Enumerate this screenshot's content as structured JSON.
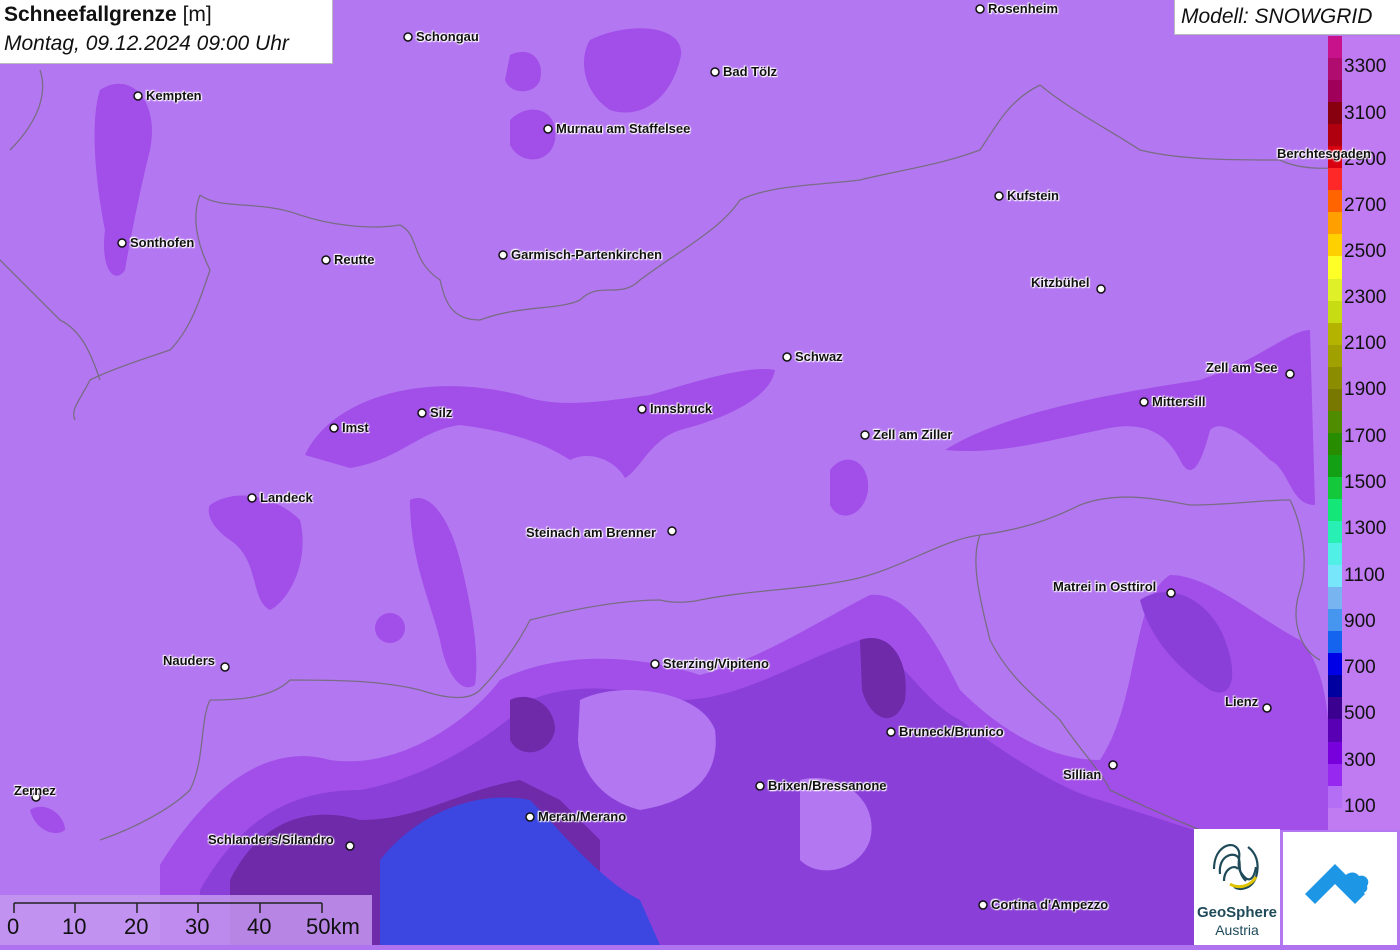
{
  "title": {
    "main": "Schneefallgrenze",
    "unit": "[m]",
    "datetime": "Montag, 09.12.2024 09:00 Uhr"
  },
  "model": "Modell: SNOWGRID",
  "legend": {
    "labels": [
      "3300",
      "3100",
      "2900",
      "2700",
      "2500",
      "2300",
      "2100",
      "1900",
      "1700",
      "1500",
      "1300",
      "1100",
      "900",
      "700",
      "500",
      "300",
      "100"
    ],
    "colors": [
      "#c8128c",
      "#b00c70",
      "#a0005a",
      "#880010",
      "#b00010",
      "#d80010",
      "#ff2828",
      "#ff6400",
      "#ffa000",
      "#ffd000",
      "#ffff28",
      "#e0f028",
      "#c8dc14",
      "#b4b400",
      "#a0a000",
      "#8c8c00",
      "#787800",
      "#508c00",
      "#288c00",
      "#14a014",
      "#14c83c",
      "#14e678",
      "#28f0b4",
      "#50f0e6",
      "#78e6fa",
      "#78b4f0",
      "#4696f0",
      "#1464f0",
      "#0000e6",
      "#0000a0",
      "#3c0090",
      "#5a00b4",
      "#7800dc",
      "#9628f0",
      "#b46ef5",
      "#c07af2"
    ]
  },
  "scale": {
    "labels": [
      "0",
      "10",
      "20",
      "30",
      "40",
      "50km"
    ]
  },
  "cities": [
    {
      "name": "Rosenheim"
    },
    {
      "name": "Schongau"
    },
    {
      "name": "Kempten"
    },
    {
      "name": "Bad Tölz"
    },
    {
      "name": "Murnau am Staffelsee"
    },
    {
      "name": "Berchtesgaden"
    },
    {
      "name": "Kufstein"
    },
    {
      "name": "Sonthofen"
    },
    {
      "name": "Reutte"
    },
    {
      "name": "Garmisch-Partenkirchen"
    },
    {
      "name": "Kitzbühel"
    },
    {
      "name": "Schwaz"
    },
    {
      "name": "Zell am See"
    },
    {
      "name": "Mittersill"
    },
    {
      "name": "Imst"
    },
    {
      "name": "Silz"
    },
    {
      "name": "Innsbruck"
    },
    {
      "name": "Zell am Ziller"
    },
    {
      "name": "Landeck"
    },
    {
      "name": "Steinach am Brenner"
    },
    {
      "name": "Matrei in Osttirol"
    },
    {
      "name": "Nauders"
    },
    {
      "name": "Sterzing/Vipiteno"
    },
    {
      "name": "Lienz"
    },
    {
      "name": "Bruneck/Brunico"
    },
    {
      "name": "Sillian"
    },
    {
      "name": "Brixen/Bressanone"
    },
    {
      "name": "Zernez"
    },
    {
      "name": "Meran/Merano"
    },
    {
      "name": "Schlanders/Silandro"
    },
    {
      "name": "Cortina d'Ampezzo"
    }
  ],
  "logos": {
    "geosphere_1": "GeoSphere",
    "geosphere_2": "Austria"
  }
}
